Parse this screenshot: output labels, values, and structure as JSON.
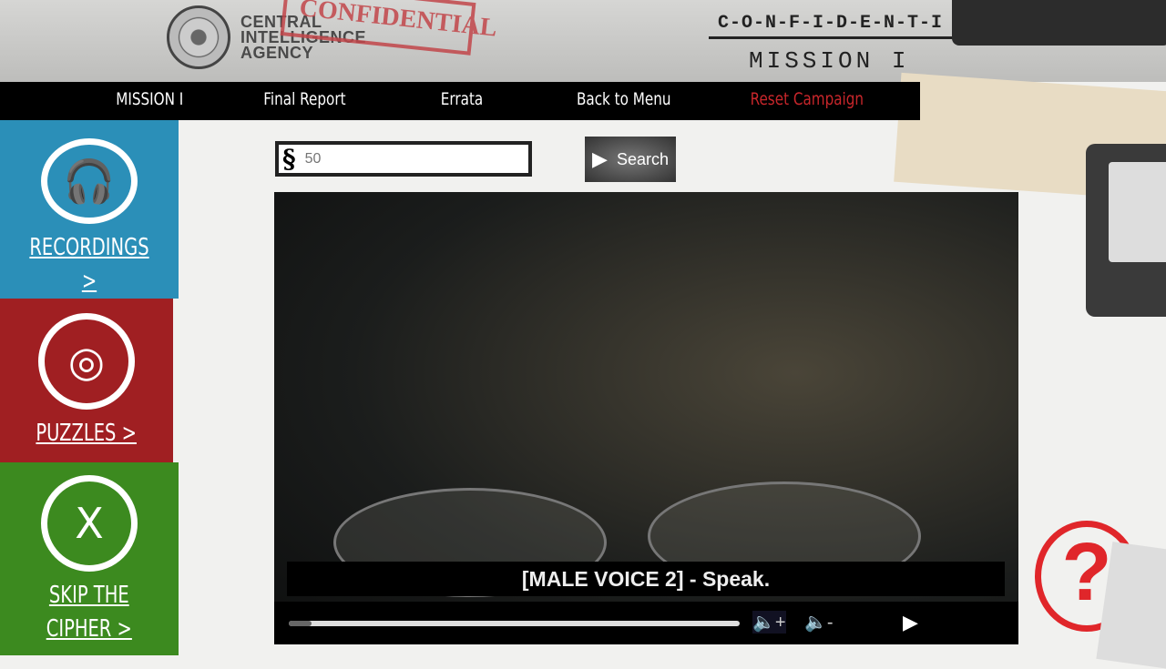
{
  "header": {
    "agency_lines": [
      "CENTRAL",
      "INTELLIGENCE",
      "AGENCY"
    ],
    "stamp": "CONFIDENTIAL",
    "classification": "C-O-N-F-I-D-E-N-T-I",
    "mission_title": "MISSION I"
  },
  "nav": {
    "items": [
      {
        "label": "MISSION I",
        "color": "#ffffff"
      },
      {
        "label": "Final Report",
        "color": "#ffffff"
      },
      {
        "label": "Errata",
        "color": "#ffffff"
      },
      {
        "label": "Back to Menu",
        "color": "#ffffff"
      },
      {
        "label": "Reset Campaign",
        "color": "#c8262b"
      }
    ]
  },
  "sidebar": {
    "recordings": {
      "label": "RECORDINGS >",
      "color": "#2b8fb8",
      "icon": "headphones-icon"
    },
    "puzzles": {
      "label": "PUZZLES >",
      "color": "#a01f22",
      "icon": "gear-icon",
      "glyph": "◎"
    },
    "skip": {
      "label_1": "SKIP THE",
      "label_2": "CIPHER >",
      "color": "#3c8a1f",
      "glyph": "X",
      "icon": "x-cipher-icon"
    }
  },
  "search": {
    "symbol": "§",
    "placeholder": "50",
    "button_label": "Search"
  },
  "player": {
    "caption": "[MALE VOICE 2] - Speak.",
    "progress_percent": 5,
    "volume_up": "🔈+",
    "volume_down": "🔈-",
    "play": "▶"
  },
  "help": {
    "glyph": "?"
  }
}
